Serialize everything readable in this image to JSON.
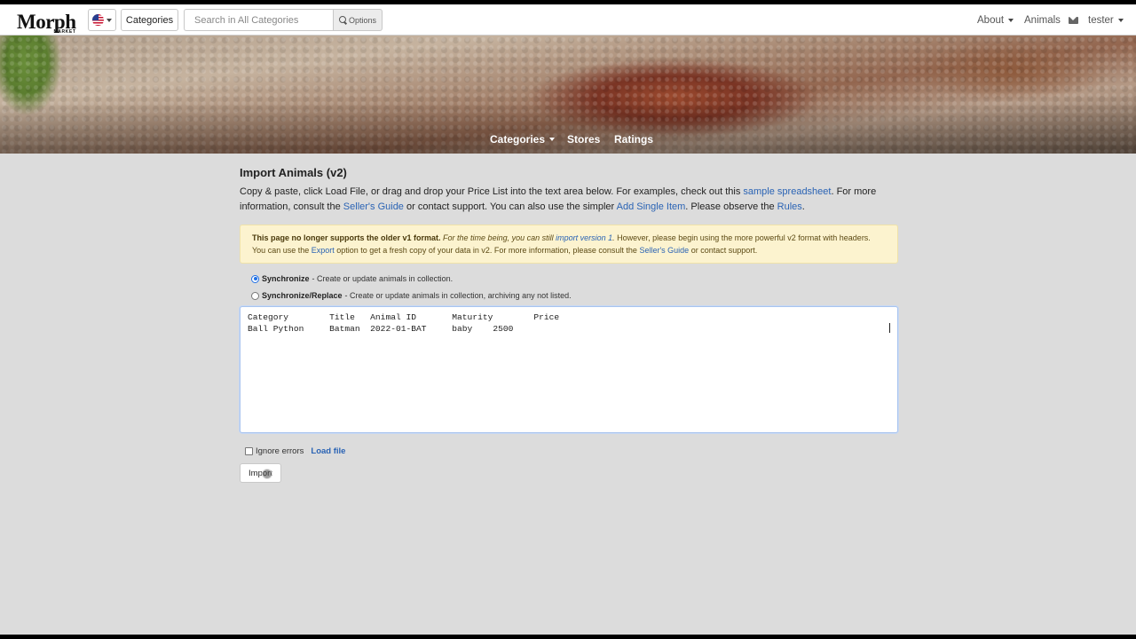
{
  "navbar": {
    "logo_text": "Morph",
    "logo_sub": "MARKET",
    "categories_button": "Categories",
    "search_placeholder": "Search in All Categories",
    "options_label": "Options",
    "about": "About",
    "animals": "Animals",
    "user": "tester"
  },
  "hero_nav": {
    "categories": "Categories",
    "stores": "Stores",
    "ratings": "Ratings"
  },
  "main": {
    "title": "Import Animals (v2)",
    "intro": {
      "p1": "Copy & paste, click Load File, or drag and drop your Price List into the text area below. For examples, check out this ",
      "link_sample": "sample spreadsheet",
      "p2": ". For more information, consult the ",
      "link_guide": "Seller's Guide",
      "p3": " or contact support. You can also use the simpler ",
      "link_add_single": "Add Single Item",
      "p4": ". Please observe the ",
      "link_rules": "Rules",
      "p5": "."
    },
    "warning": {
      "bold": "This page no longer supports the older v1 format.",
      "italic_prefix": "For the time being, you can still ",
      "italic_link": "import version 1",
      "italic_suffix": ".",
      "p1": " However, please begin using the more powerful v2 format with headers. You can use the ",
      "link_export": "Export",
      "p2": " option to get a fresh copy of your data in v2. For more information, please consult the ",
      "link_guide": "Seller's Guide",
      "p3": " or contact support."
    },
    "radio_sync": {
      "label": "Synchronize",
      "desc": "- Create or update animals in collection.",
      "checked": true
    },
    "radio_sync_replace": {
      "label": "Synchronize/Replace",
      "desc": "- Create or update animals in collection, archiving any not listed.",
      "checked": false
    },
    "textarea_value": "Category        Title   Animal ID       Maturity        Price\nBall Python     Batman  2022-01-BAT     baby    2500",
    "ignore_errors_label": "Ignore errors",
    "load_file_label": "Load file",
    "import_button": "Import"
  },
  "colors": {
    "link": "#2a63b4",
    "warning_bg": "#fcf3cf",
    "page_bg": "#dcdcdc",
    "radio_selected": "#1f6fe5"
  },
  "icons": [
    "flag-us-icon",
    "search-icon",
    "envelope-icon",
    "caret-down-icon"
  ]
}
